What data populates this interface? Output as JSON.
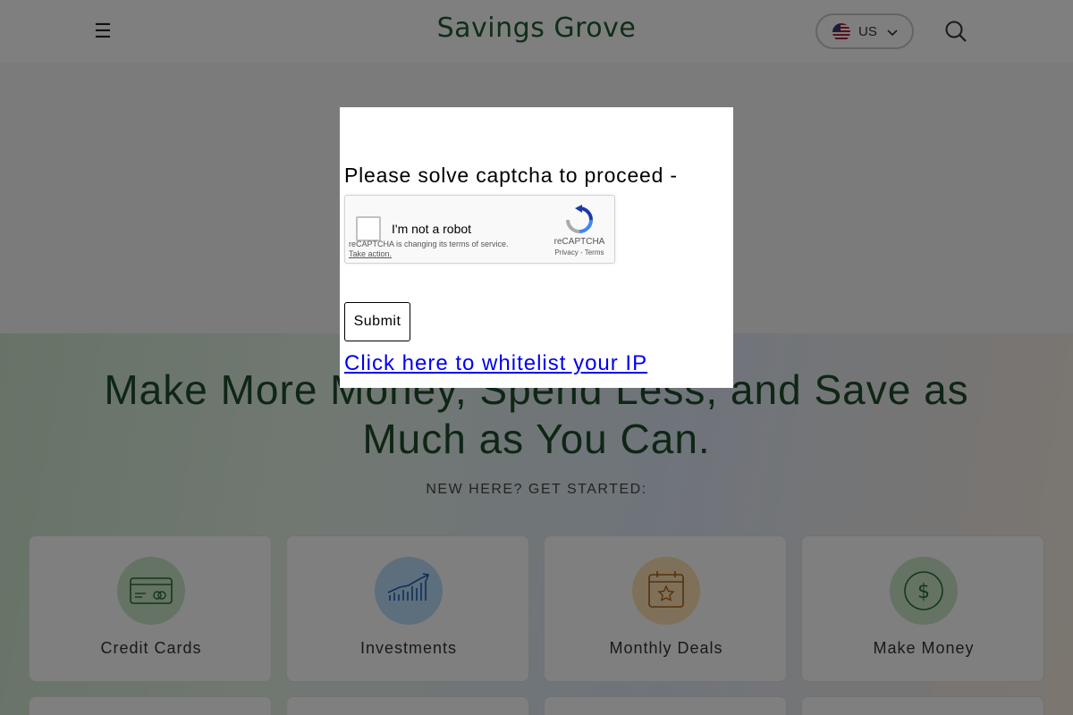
{
  "header": {
    "menu_icon": "hamburger-icon",
    "logo_text": "Savings Grove",
    "region_label": "US",
    "flag_icon": "us-flag-icon",
    "chevron_icon": "chevron-down-icon",
    "search_icon": "search-icon"
  },
  "hero": {
    "title": "Make More Money, Spend Less, and Save as Much as You Can.",
    "subtitle": "NEW HERE? GET STARTED:",
    "cards": [
      {
        "label": "Credit Cards",
        "icon": "credit-card-icon",
        "icon_bg": "#c8e6c9"
      },
      {
        "label": "Investments",
        "icon": "chart-growth-icon",
        "icon_bg": "#bbdefb"
      },
      {
        "label": "Monthly Deals",
        "icon": "calendar-star-icon",
        "icon_bg": "#ffe0b2"
      },
      {
        "label": "Make Money",
        "icon": "dollar-coin-icon",
        "icon_bg": "#c8e6c9"
      }
    ]
  },
  "captcha_modal": {
    "message": "Please solve captcha to proceed -",
    "recaptcha": {
      "checkbox_label": "I'm not a robot",
      "notice": "reCAPTCHA is changing its terms of service.",
      "notice_action": "Take action.",
      "brand": "reCAPTCHA",
      "links": "Privacy - Terms"
    },
    "submit_label": "Submit",
    "whitelist_link": "Click here to whitelist your IP"
  },
  "colors": {
    "brand_green": "#1f5c2e",
    "link_blue": "#0000ee",
    "overlay": "rgba(0,0,0,0.5)"
  }
}
